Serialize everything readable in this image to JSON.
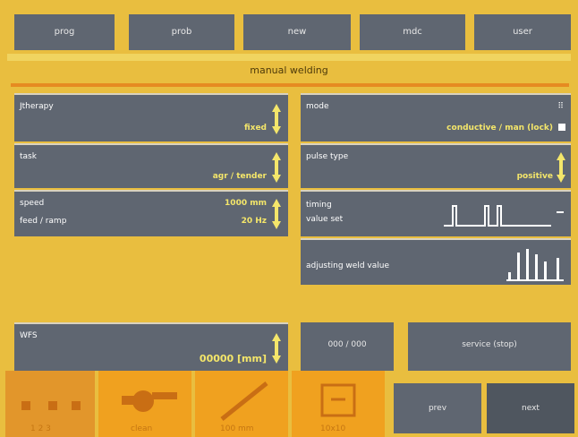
{
  "tabs": [
    {
      "label": "prog"
    },
    {
      "label": "prob"
    },
    {
      "label": "new"
    },
    {
      "label": "mdc"
    },
    {
      "label": "user"
    }
  ],
  "page_title": "manual welding",
  "left": {
    "jtherapy": {
      "label": "Jtherapy",
      "value": "fixed"
    },
    "task": {
      "label": "task",
      "value": "agr / tender"
    },
    "speed": {
      "label": "speed",
      "value": "1000 mm"
    },
    "feed": {
      "label": "feed / ramp",
      "value": "20 Hz"
    },
    "wfs": {
      "label": "WFS",
      "value": "00000 [mm]"
    }
  },
  "right": {
    "mode": {
      "label": "mode",
      "value": "conductive / man (lock)"
    },
    "pulse": {
      "label": "pulse type",
      "value": "positive"
    },
    "timing": {
      "label1": "timing",
      "label2": "value set"
    },
    "adjust": {
      "label": "adjusting weld value"
    }
  },
  "bottom_buttons": {
    "keypad_label": "000 / 000",
    "service": "service (stop)"
  },
  "softkeys": [
    {
      "id": "mode",
      "label": "1 2 3"
    },
    {
      "id": "torch",
      "label": "clean"
    },
    {
      "id": "wire",
      "label": "100 mm"
    },
    {
      "id": "box",
      "label": "10x10"
    }
  ],
  "nav": {
    "prev": "prev",
    "next": "next"
  },
  "colors": {
    "background": "#e9be3f",
    "panel": "#5f6671",
    "accent": "#f4e66a",
    "softkey": "#f0a11f"
  }
}
